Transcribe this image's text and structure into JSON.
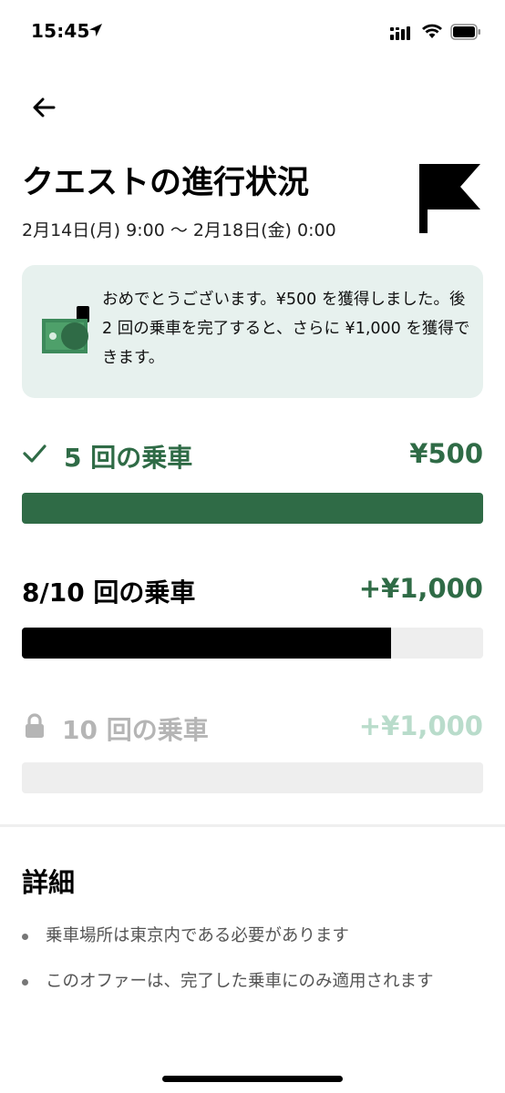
{
  "status_bar": {
    "time": "15:45"
  },
  "header": {
    "title": "クエストの進行状況",
    "date_range": "2月14日(月) 9:00 〜 2月18日(金) 0:00"
  },
  "banner": {
    "message": "おめでとうございます。¥500 を獲得しました。後 2 回の乗車を完了すると、さらに ¥1,000 を獲得できます。"
  },
  "tiers": [
    {
      "label": "5 回の乗車",
      "amount": "¥500",
      "progress": 1.0,
      "state": "completed"
    },
    {
      "label": "8/10 回の乗車",
      "amount": "+¥1,000",
      "progress": 0.8,
      "state": "in-progress"
    },
    {
      "label": "10 回の乗車",
      "amount": "+¥1,000",
      "progress": 0.0,
      "state": "locked"
    }
  ],
  "details": {
    "title": "詳細",
    "items": [
      "乗車場所は東京内である必要があります",
      "このオファーは、完了した乗車にのみ適用されます"
    ]
  },
  "colors": {
    "accent_green": "#2f6b46",
    "banner_bg": "#e7f1ee",
    "locked_amount": "#b9dccb",
    "bar_track": "#eeeeee"
  },
  "icons": [
    "location-arrow-icon",
    "signal-icon",
    "wifi-icon",
    "battery-icon",
    "back-arrow-icon",
    "flag-icon",
    "cash-icon",
    "check-icon",
    "lock-icon"
  ]
}
